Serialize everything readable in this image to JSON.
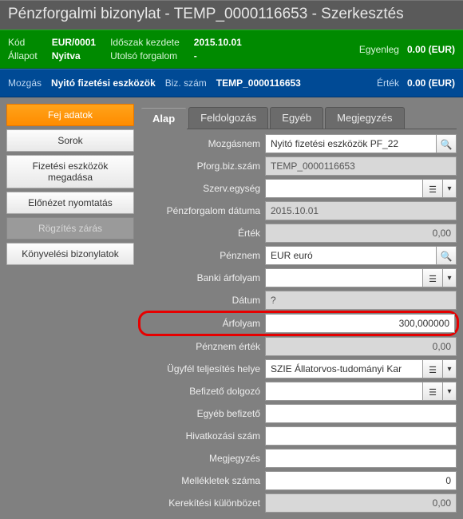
{
  "title": "Pénzforgalmi bizonylat - TEMP_0000116653 - Szerkesztés",
  "green": {
    "kod_lbl": "Kód",
    "kod_val": "EUR/0001",
    "allapot_lbl": "Állapot",
    "allapot_val": "Nyitva",
    "idoszak_lbl": "Időszak kezdete",
    "idoszak_val": "2015.10.01",
    "utolso_lbl": "Utolsó forgalom",
    "utolso_val": "-",
    "egyenleg_lbl": "Egyenleg",
    "egyenleg_val": "0.00 (EUR)"
  },
  "blue": {
    "mozgas_lbl": "Mozgás",
    "mozgas_val": "Nyitó fizetési eszközök",
    "bizszam_lbl": "Biz. szám",
    "bizszam_val": "TEMP_0000116653",
    "ertek_lbl": "Érték",
    "ertek_val": "0.00 (EUR)"
  },
  "sidebar": {
    "fej": "Fej adatok",
    "sorok": "Sorok",
    "fizetesi": "Fizetési eszközök megadása",
    "elonezet": "Előnézet nyomtatás",
    "rogzites": "Rögzítés zárás",
    "konyv": "Könyvelési bizonylatok"
  },
  "tabs": {
    "alap": "Alap",
    "feldolg": "Feldolgozás",
    "egyeb": "Egyéb",
    "megj": "Megjegyzés"
  },
  "form": {
    "mozgasnem_lbl": "Mozgásnem",
    "mozgasnem_val": "Nyitó fizetési eszközök PF_22",
    "pforg_lbl": "Pforg.biz.szám",
    "pforg_val": "TEMP_0000116653",
    "szerv_lbl": "Szerv.egység",
    "szerv_val": "",
    "datum_lbl": "Pénzforgalom dátuma",
    "datum_val": "2015.10.01",
    "ertek_lbl": "Érték",
    "ertek_val": "0,00",
    "penznem_lbl": "Pénznem",
    "penznem_val": "EUR euró",
    "banki_lbl": "Banki árfolyam",
    "banki_val": "",
    "datum2_lbl": "Dátum",
    "datum2_val": "?",
    "arfolyam_lbl": "Árfolyam",
    "arfolyam_val": "300,000000",
    "penznemertek_lbl": "Pénznem érték",
    "penznemertek_val": "0,00",
    "ugyfel_lbl": "Ügyfél teljesítés helye",
    "ugyfel_val": "SZIE Állatorvos-tudományi Kar",
    "befizeto_lbl": "Befizető dolgozó",
    "befizeto_val": "",
    "egyebbf_lbl": "Egyéb befizető",
    "egyebbf_val": "",
    "hiv_lbl": "Hivatkozási szám",
    "hiv_val": "",
    "megj_lbl": "Megjegyzés",
    "megj_val": "",
    "mellek_lbl": "Mellékletek száma",
    "mellek_val": "0",
    "kerekites_lbl": "Kerekítési különbözet",
    "kerekites_val": "0,00"
  }
}
